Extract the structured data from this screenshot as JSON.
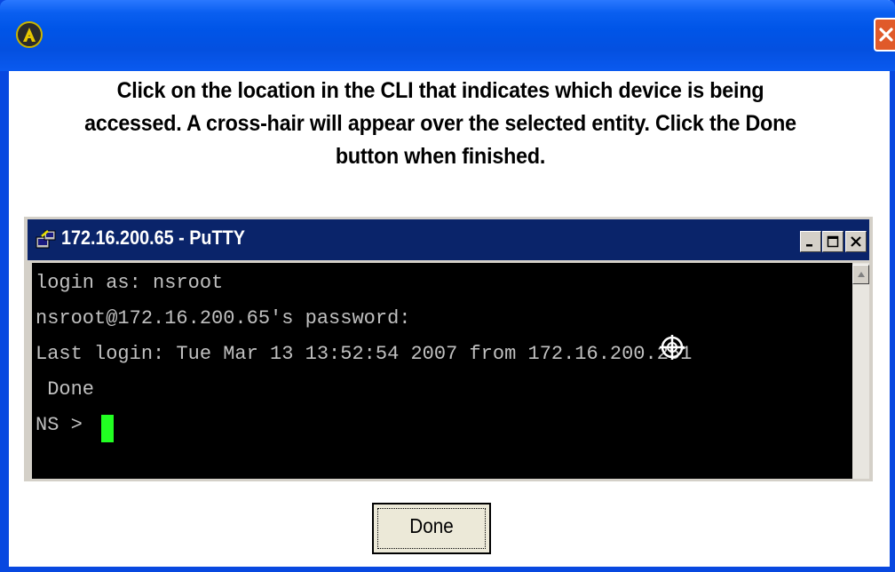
{
  "window": {
    "icon": "app-logo-icon",
    "close_icon": "close-icon"
  },
  "instructions": {
    "line1": "Click on the location in the CLI that indicates which device is being",
    "line2": "accessed. A cross-hair will appear over the selected entity. Click the Done",
    "line3": "button when finished."
  },
  "putty": {
    "title": "172.16.200.65 - PuTTY",
    "icon": "putty-icon",
    "buttons": [
      "minimize-icon",
      "maximize-icon",
      "close-icon"
    ],
    "terminal_lines": [
      "login as: nsroot",
      "nsroot@172.16.200.65's password:",
      "Last login: Tue Mar 13 13:52:54 2007 from 172.16.200.251",
      " Done",
      "NS > "
    ],
    "cursor_color": "#22ff22"
  },
  "done_button": {
    "label": "Done"
  },
  "colors": {
    "frame": "#0848e0",
    "putty_titlebar": "#0a246a",
    "terminal_bg": "#000000",
    "terminal_text": "#c0c0c0"
  }
}
